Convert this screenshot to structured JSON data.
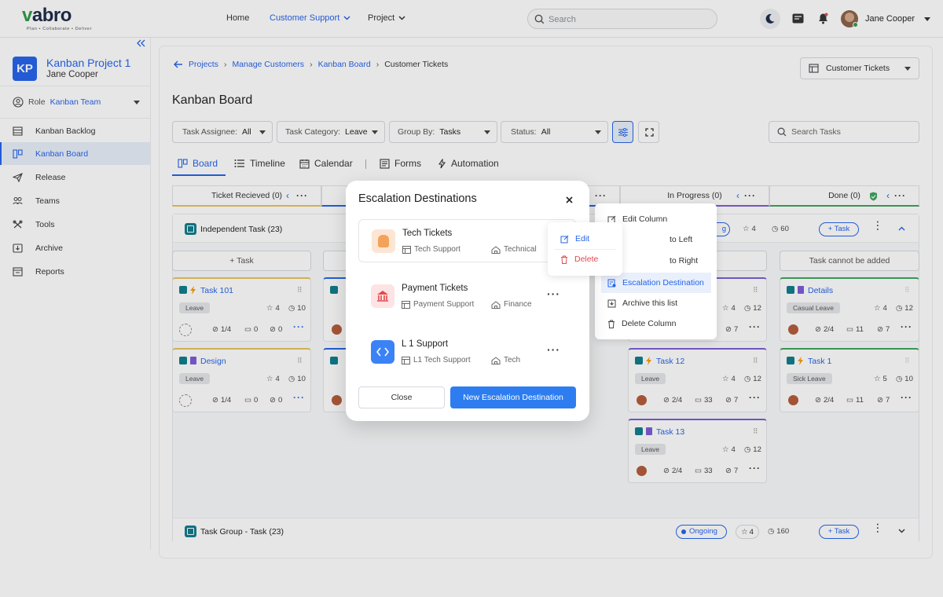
{
  "brand": {
    "name_v": "v",
    "name_rest": "abro",
    "tagline": "Plan • Collaborate • Deliver"
  },
  "topnav": {
    "home": "Home",
    "customer_support": "Customer Support",
    "project": "Project",
    "search_placeholder": "Search",
    "user_name": "Jane Cooper"
  },
  "sidebar": {
    "project_initials": "KP",
    "project_name": "Kanban Project 1",
    "owner": "Jane Cooper",
    "role_label": "Role",
    "role_value": "Kanban Team",
    "items": [
      {
        "label": "Kanban Backlog",
        "icon": "backlog-icon"
      },
      {
        "label": "Kanban Board",
        "icon": "board-icon"
      },
      {
        "label": "Release",
        "icon": "release-icon"
      },
      {
        "label": "Teams",
        "icon": "teams-icon"
      },
      {
        "label": "Tools",
        "icon": "tools-icon"
      },
      {
        "label": "Archive",
        "icon": "archive-icon"
      },
      {
        "label": "Reports",
        "icon": "reports-icon"
      }
    ]
  },
  "breadcrumb": [
    "Projects",
    "Manage Customers",
    "Kanban Board",
    "Customer Tickets"
  ],
  "view_select": "Customer Tickets",
  "page_title": "Kanban Board",
  "filters": {
    "assignee_label": "Task Assignee:",
    "assignee_value": "All",
    "category_label": "Task Category:",
    "category_value": "Leave",
    "group_label": "Group By:",
    "group_value": "Tasks",
    "status_label": "Status:",
    "status_value": "All",
    "search_placeholder": "Search Tasks"
  },
  "tabs": [
    "Board",
    "Timeline",
    "Calendar",
    "Forms",
    "Automation"
  ],
  "columns": [
    {
      "label": "Ticket Recieved (0)",
      "color": "#e8c25a"
    },
    {
      "label": "In Progress (0)",
      "color": "#7c5cd6"
    },
    {
      "label": "Done (0)",
      "color": "#3da35d"
    }
  ],
  "group1": {
    "title": "Independent Task (23)",
    "status": "Ongoing",
    "stars": "4",
    "time": "60",
    "add": "+ Task"
  },
  "group2": {
    "title": "Task Group - Task (23)",
    "status": "Ongoing",
    "stars": "4",
    "time": "160",
    "add": "+ Task"
  },
  "add_task": "+ Task",
  "cannot_add": "Task cannot be added",
  "cards": {
    "c101": {
      "title": "Task 101",
      "tag": "Leave",
      "stars": "4",
      "time": "10",
      "check": "1/4",
      "comments": "0",
      "attach": "0"
    },
    "design": {
      "title": "Design",
      "tag": "Leave",
      "stars": "4",
      "time": "10",
      "check": "1/4",
      "comments": "0",
      "attach": "0"
    },
    "inprog1": {
      "stars": "4",
      "time": "12",
      "attach": "7"
    },
    "task12": {
      "title": "Task 12",
      "tag": "Leave",
      "stars": "4",
      "time": "12",
      "check": "2/4",
      "comments": "33",
      "attach": "7"
    },
    "task13": {
      "title": "Task 13",
      "tag": "Leave",
      "stars": "4",
      "time": "12",
      "check": "2/4",
      "comments": "33",
      "attach": "7"
    },
    "details": {
      "title": "Details",
      "tag": "Casual Leave",
      "stars": "4",
      "time": "12",
      "check": "2/4",
      "comments": "11",
      "attach": "7"
    },
    "task1": {
      "title": "Task 1",
      "tag": "Sick Leave",
      "stars": "5",
      "time": "10",
      "check": "2/4",
      "comments": "11",
      "attach": "7"
    }
  },
  "column_menu": [
    "Edit Column",
    "to Left",
    "to Right",
    "Escalation Destination",
    "Archive this list",
    "Delete Column"
  ],
  "modal": {
    "title": "Escalation Destinations",
    "destinations": [
      {
        "name": "Tech Tickets",
        "team": "Tech Support",
        "dept": "Technical"
      },
      {
        "name": "Payment Tickets",
        "team": "Payment Support",
        "dept": "Finance"
      },
      {
        "name": "L 1 Support",
        "team": "L1 Tech Support",
        "dept": "Tech"
      }
    ],
    "close": "Close",
    "new": "New Escalation Destination"
  },
  "row_menu": {
    "edit": "Edit",
    "delete": "Delete"
  },
  "colors": {
    "accent": "#2563eb",
    "danger": "#e5484d",
    "brand_green": "#2f9a44"
  }
}
